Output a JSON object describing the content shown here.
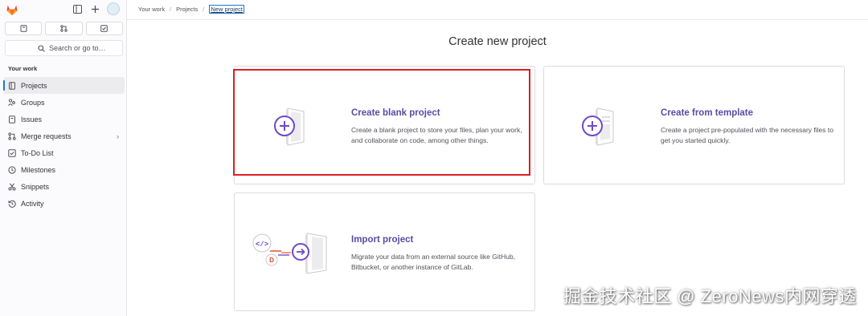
{
  "sidebar": {
    "search_placeholder": "Search or go to…",
    "section_title": "Your work",
    "items": [
      {
        "label": "Projects",
        "icon": "project-icon"
      },
      {
        "label": "Groups",
        "icon": "group-icon"
      },
      {
        "label": "Issues",
        "icon": "issues-icon"
      },
      {
        "label": "Merge requests",
        "icon": "merge-request-icon"
      },
      {
        "label": "To-Do List",
        "icon": "todo-icon"
      },
      {
        "label": "Milestones",
        "icon": "milestone-icon"
      },
      {
        "label": "Snippets",
        "icon": "snippet-icon"
      },
      {
        "label": "Activity",
        "icon": "history-icon"
      }
    ]
  },
  "breadcrumb": [
    "Your work",
    "Projects",
    "New project"
  ],
  "main": {
    "title": "Create new project",
    "cards": [
      {
        "title": "Create blank project",
        "desc": "Create a blank project to store your files, plan your work, and collaborate on code, among other things."
      },
      {
        "title": "Create from template",
        "desc": "Create a project pre-populated with the necessary files to get you started quickly."
      },
      {
        "title": "Import project",
        "desc": "Migrate your data from an external source like GitHub, Bitbucket, or another instance of GitLab."
      }
    ]
  },
  "watermark": "掘金技术社区 @ ZeroNews内网穿透",
  "colors": {
    "accent": "#5b4aa6",
    "active_bar": "#1f75cb",
    "highlight": "#e01e1e"
  }
}
